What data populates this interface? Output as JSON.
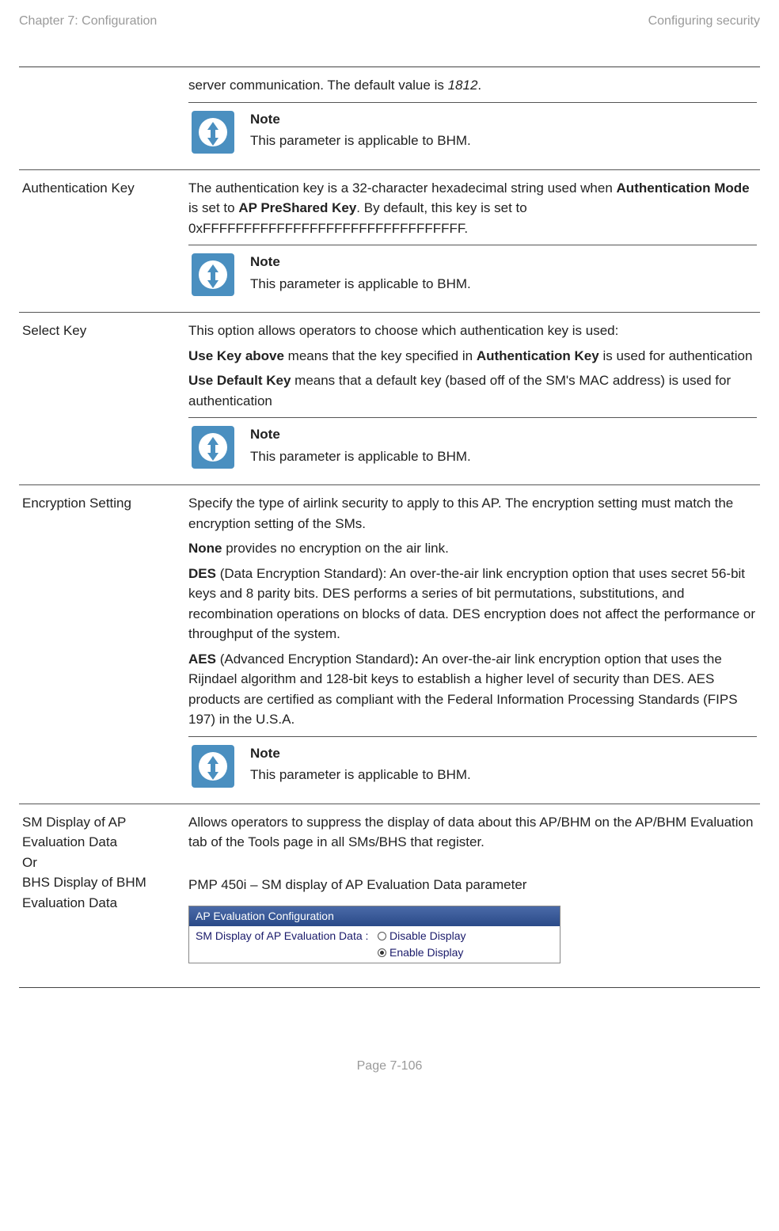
{
  "header": {
    "left": "Chapter 7:  Configuration",
    "right": "Configuring security"
  },
  "rows": {
    "r0": {
      "desc_a": "server communication.  The default value is ",
      "desc_b": "1812",
      "desc_c": ".",
      "note_title": "Note",
      "note_text": "This parameter is applicable to BHM."
    },
    "r1": {
      "label": "Authentication Key",
      "p1a": "The authentication key is a 32-character hexadecimal string used when ",
      "p1b": "Authentication Mode",
      "p1c": " is set to ",
      "p1d": "AP PreShared Key",
      "p1e": ". By default, this key is set to 0xFFFFFFFFFFFFFFFFFFFFFFFFFFFFFFFF.",
      "note_title": "Note",
      "note_text": "This parameter is applicable to BHM."
    },
    "r2": {
      "label": "Select Key",
      "p1": "This option allows operators to choose which authentication key is used:",
      "p2a": "Use Key above",
      "p2b": " means that the key specified in ",
      "p2c": "Authentication Key",
      "p2d": " is used for authentication",
      "p3a": "Use Default Key",
      "p3b": " means that a default key (based off of the SM's MAC address) is used for authentication",
      "note_title": "Note",
      "note_text": "This parameter is applicable to BHM."
    },
    "r3": {
      "label": "Encryption Setting",
      "p1": "Specify the type of airlink security to apply to this AP. The encryption setting must match the encryption setting of the SMs.",
      "p2a": "None",
      "p2b": " provides no encryption on the air link.",
      "p3a": "DES",
      "p3b": " (Data Encryption Standard): An over-the-air link encryption option that uses secret 56-bit keys and 8 parity bits. DES performs a series of bit permutations, substitutions, and recombination operations on blocks of data.  DES encryption does not affect the performance or throughput of the system.",
      "p4a": "AES",
      "p4b": " (Advanced Encryption Standard)",
      "p4c": ":",
      "p4d": " An over-the-air link encryption option that uses the Rijndael algorithm and 128-bit keys to establish a higher level of security than DES. AES products are certified as compliant with the Federal Information Processing Standards (FIPS 197) in the U.S.A.",
      "note_title": "Note",
      "note_text": "This parameter is applicable to BHM."
    },
    "r4": {
      "label_l1": "SM Display of AP Evaluation Data",
      "label_l2": "Or",
      "label_l3": "BHS Display of BHM Evaluation Data",
      "p1": "Allows operators to suppress the display of data about this AP/BHM on the AP/BHM Evaluation tab of the Tools page in all SMs/BHS that register.",
      "p2": "PMP 450i – SM display of AP Evaluation Data parameter",
      "box": {
        "title": "AP Evaluation Configuration",
        "label": "SM Display of AP Evaluation Data :",
        "opt1": "Disable Display",
        "opt2": "Enable Display"
      }
    }
  },
  "footer": "Page 7-106"
}
